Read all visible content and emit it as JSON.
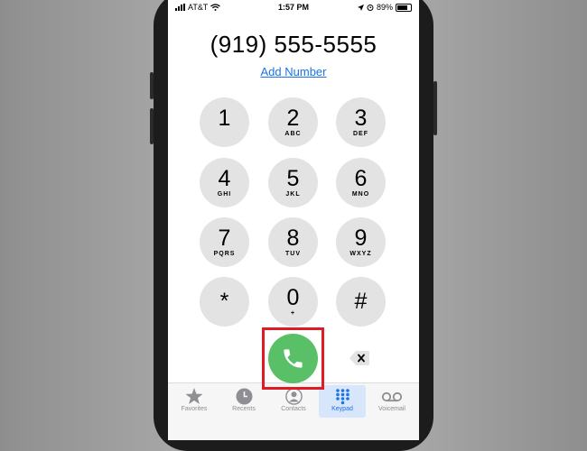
{
  "status_bar": {
    "carrier": "AT&T",
    "time": "1:57 PM",
    "battery": "89%"
  },
  "dialer": {
    "number": "(919) 555-5555",
    "add_number": "Add Number"
  },
  "keypad": {
    "keys": [
      {
        "digit": "1",
        "letters": ""
      },
      {
        "digit": "2",
        "letters": "ABC"
      },
      {
        "digit": "3",
        "letters": "DEF"
      },
      {
        "digit": "4",
        "letters": "GHI"
      },
      {
        "digit": "5",
        "letters": "JKL"
      },
      {
        "digit": "6",
        "letters": "MNO"
      },
      {
        "digit": "7",
        "letters": "PQRS"
      },
      {
        "digit": "8",
        "letters": "TUV"
      },
      {
        "digit": "9",
        "letters": "WXYZ"
      },
      {
        "digit": "*",
        "letters": ""
      },
      {
        "digit": "0",
        "letters": "+"
      },
      {
        "digit": "#",
        "letters": ""
      }
    ]
  },
  "tabs": [
    {
      "label": "Favorites",
      "icon": "star-icon"
    },
    {
      "label": "Recents",
      "icon": "clock-icon"
    },
    {
      "label": "Contacts",
      "icon": "person-icon"
    },
    {
      "label": "Keypad",
      "icon": "keypad-icon",
      "active": true
    },
    {
      "label": "Voicemail",
      "icon": "voicemail-icon"
    }
  ],
  "colors": {
    "call_green": "#59c067",
    "highlight_red": "#e01b24",
    "accent_blue": "#1a73e8",
    "key_gray": "#e3e3e3"
  }
}
